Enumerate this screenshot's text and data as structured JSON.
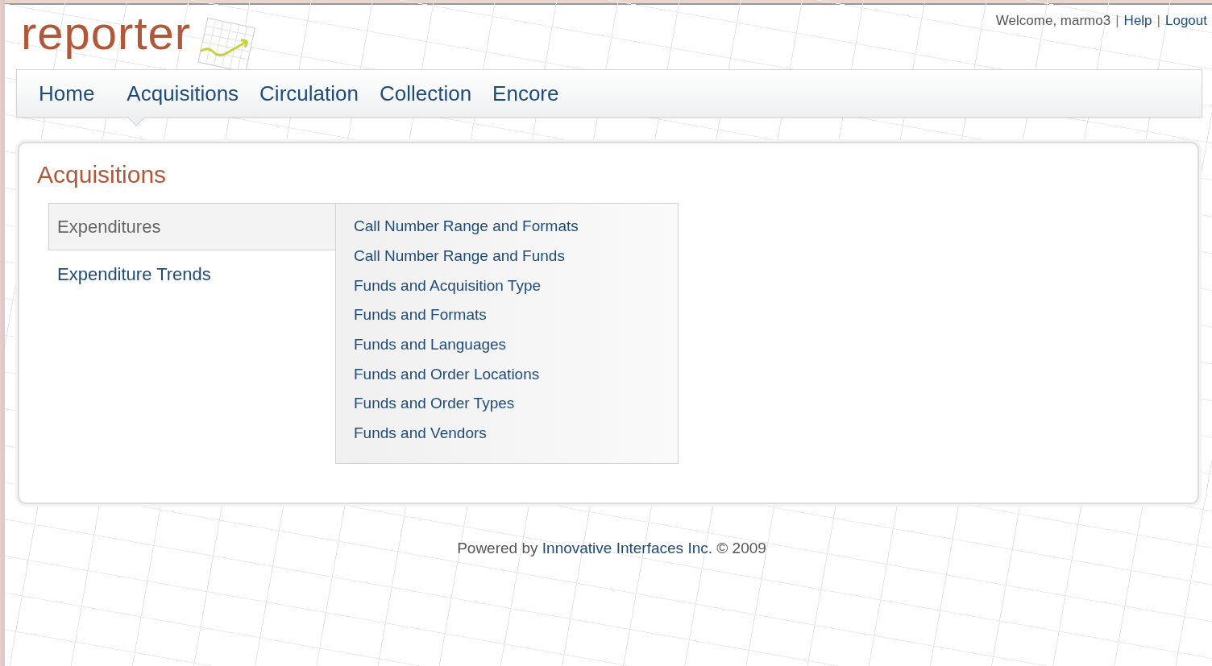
{
  "logo": {
    "text": "reporter"
  },
  "user_links": [
    {
      "kind": "text",
      "label": "Welcome, marmo3"
    },
    {
      "kind": "separator",
      "label": "|"
    },
    {
      "kind": "link",
      "label": "Help"
    },
    {
      "kind": "separator",
      "label": "|"
    },
    {
      "kind": "link",
      "label": "Logout"
    }
  ],
  "nav": [
    {
      "label": "Home",
      "selected": false
    },
    {
      "label": "Acquisitions",
      "selected": true
    },
    {
      "label": "Circulation",
      "selected": false
    },
    {
      "label": "Collection",
      "selected": false
    },
    {
      "label": "Encore",
      "selected": false
    }
  ],
  "page_title": "Acquisitions",
  "side_menu": [
    {
      "label": "Expenditures",
      "selected": true
    },
    {
      "label": "Expenditure Trends",
      "selected": false
    }
  ],
  "reports": [
    "Call Number Range and Formats",
    "Call Number Range and Funds",
    "Funds and Acquisition Type",
    "Funds and Formats",
    "Funds and Languages",
    "Funds and Order Locations",
    "Funds and Order Types",
    "Funds and Vendors"
  ],
  "footer": {
    "prefix": "Powered by",
    "link": "Innovative Interfaces Inc.",
    "suffix": "© 2009"
  }
}
